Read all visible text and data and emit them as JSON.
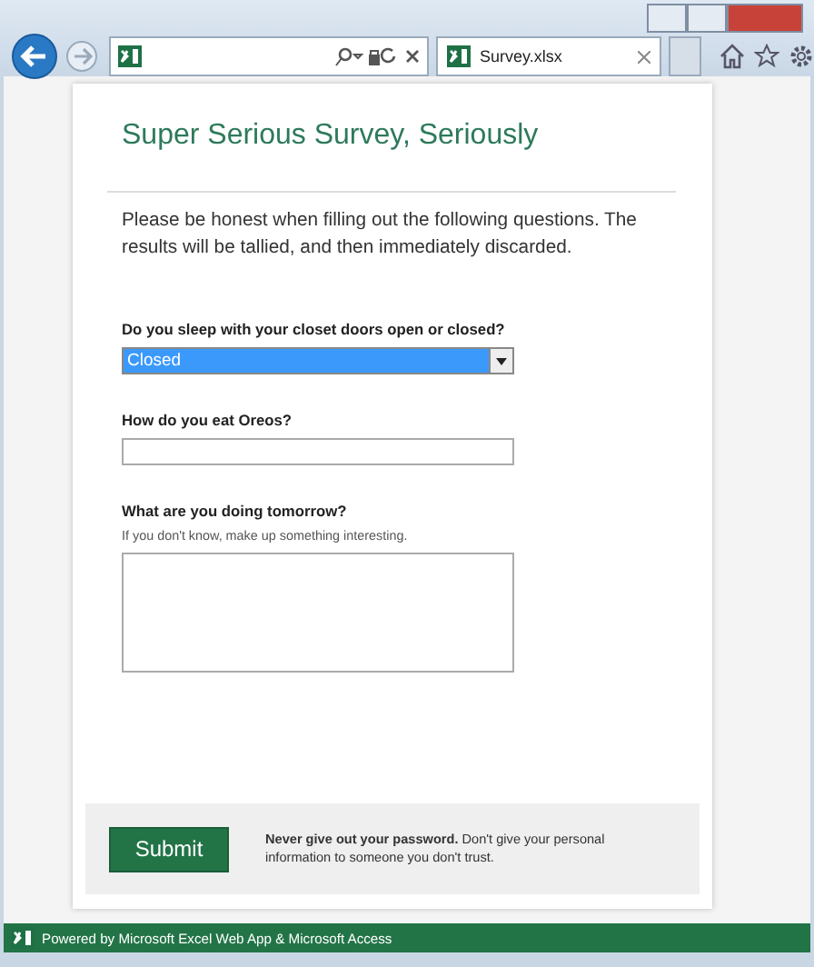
{
  "browser": {
    "tab_title": "Survey.xlsx"
  },
  "form": {
    "title": "Super Serious Survey, Seriously",
    "intro": "Please be honest when filling out the following questions.  The results will be tallied, and then immediately discarded.",
    "questions": [
      {
        "kind": "select",
        "label": "Do you sleep with your closet doors open or closed?",
        "value": "Closed"
      },
      {
        "kind": "text",
        "label": "How do you eat Oreos?"
      },
      {
        "kind": "textarea",
        "label": "What are you doing tomorrow?",
        "hint": "If you don't know, make up something interesting."
      }
    ],
    "submit": "Submit",
    "notice": "**Never give out your password.** Don't give your personal information to someone you don't trust."
  },
  "status_bar": {
    "text": "Powered by Microsoft Excel Web App & Microsoft Access"
  }
}
